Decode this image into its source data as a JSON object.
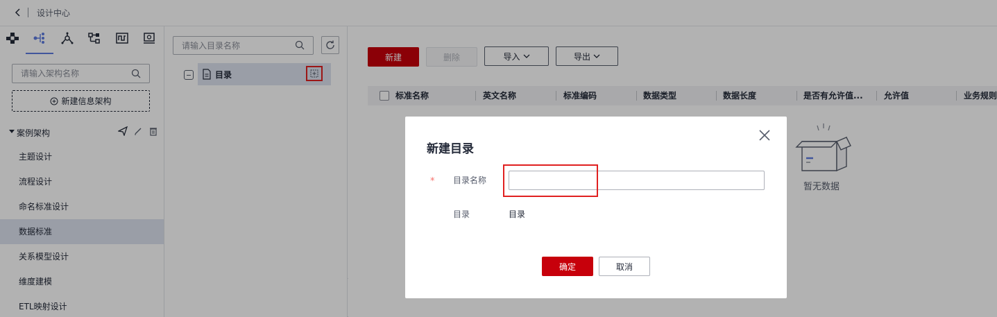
{
  "topbar": {
    "breadcrumb": "设计中心"
  },
  "left": {
    "icon_tabs": [
      "network-icon",
      "tree-icon",
      "hub-icon",
      "flow-icon",
      "pipeline-icon",
      "monitor-icon"
    ],
    "active_tab_index": 1,
    "search_placeholder": "请输入架构名称",
    "new_arch_label": "新建信息架构",
    "arch_name": "案例架构",
    "nav_items": [
      "主题设计",
      "流程设计",
      "命名标准设计",
      "数据标准",
      "关系模型设计",
      "维度建模",
      "ETL映射设计"
    ],
    "active_nav_index": 3
  },
  "tree": {
    "search_placeholder": "请输入目录名称",
    "root_label": "目录"
  },
  "toolbar": {
    "new_label": "新建",
    "delete_label": "删除",
    "import_label": "导入",
    "export_label": "导出"
  },
  "table": {
    "columns": [
      "标准名称",
      "英文名称",
      "标准编码",
      "数据类型",
      "数据长度",
      "是否有允许值...",
      "允许值",
      "业务规则"
    ],
    "empty_text": "暂无数据"
  },
  "dialog": {
    "title": "新建目录",
    "name_label": "目录名称",
    "name_value": "",
    "dir_label": "目录",
    "dir_value": "目录",
    "ok_label": "确定",
    "cancel_label": "取消"
  },
  "colors": {
    "primary": "#c7000b",
    "highlight": "#e02020",
    "active_bg": "#dde2ef",
    "tab_indicator": "#5e7ce0"
  }
}
